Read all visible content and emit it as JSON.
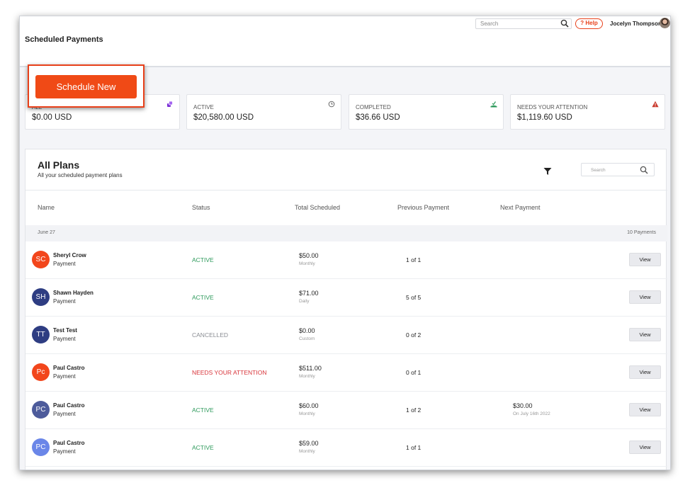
{
  "topbar": {
    "search_placeholder": "Search",
    "help_label": "? Help",
    "user_name": "Jocelyn Thompson"
  },
  "page": {
    "title": "Scheduled Payments",
    "schedule_new_label": "Schedule New"
  },
  "stats": [
    {
      "label": "ALL",
      "value": "$0.00 USD",
      "icon": "stack-icon",
      "icon_color": "#7b2fd6"
    },
    {
      "label": "ACTIVE",
      "value": "$20,580.00 USD",
      "icon": "clock-icon",
      "icon_color": "#666666"
    },
    {
      "label": "COMPLETED",
      "value": "$36.66 USD",
      "icon": "check-tray-icon",
      "icon_color": "#2e9a5c"
    },
    {
      "label": "NEEDS YOUR ATTENTION",
      "value": "$1,119.60 USD",
      "icon": "warning-icon",
      "icon_color": "#c93a2e"
    }
  ],
  "plans": {
    "title": "All Plans",
    "subtitle": "All your scheduled payment plans",
    "search_placeholder": "Search",
    "columns": [
      "Name",
      "Status",
      "Total Scheduled",
      "Previous Payment",
      "Next Payment"
    ],
    "group": {
      "date": "June 27",
      "count": "10 Payments"
    },
    "view_label": "View",
    "rows": [
      {
        "initials": "SC",
        "avatar_color": "#f2461c",
        "name": "Sheryl Crow",
        "type": "Payment",
        "status": "ACTIVE",
        "status_color": "#2e9a5c",
        "amount": "$50.00",
        "frequency": "Monthly",
        "previous": "1 of 1",
        "next": "",
        "next_date": ""
      },
      {
        "initials": "SH",
        "avatar_color": "#2e3d82",
        "name": "Shawn Hayden",
        "type": "Payment",
        "status": "ACTIVE",
        "status_color": "#2e9a5c",
        "amount": "$71.00",
        "frequency": "Daily",
        "previous": "5 of 5",
        "next": "",
        "next_date": ""
      },
      {
        "initials": "TT",
        "avatar_color": "#2e3d82",
        "name": "Test Test",
        "type": "Payment",
        "status": "CANCELLED",
        "status_color": "#8a8d93",
        "amount": "$0.00",
        "frequency": "Custom",
        "previous": "0 of 2",
        "next": "",
        "next_date": ""
      },
      {
        "initials": "Pc",
        "avatar_color": "#f2461c",
        "name": "Paul Castro",
        "type": "Payment",
        "status": "NEEDS YOUR ATTENTION",
        "status_color": "#d8343a",
        "amount": "$511.00",
        "frequency": "Monthly",
        "previous": "0 of 1",
        "next": "",
        "next_date": ""
      },
      {
        "initials": "PC",
        "avatar_color": "#4d5b9b",
        "name": "Paul Castro",
        "type": "Payment",
        "status": "ACTIVE",
        "status_color": "#2e9a5c",
        "amount": "$60.00",
        "frequency": "Monthly",
        "previous": "1 of 2",
        "next": "$30.00",
        "next_date": "On July 16th 2022"
      },
      {
        "initials": "PC",
        "avatar_color": "#6a86e8",
        "name": "Paul Castro",
        "type": "Payment",
        "status": "ACTIVE",
        "status_color": "#2e9a5c",
        "amount": "$59.00",
        "frequency": "Monthly",
        "previous": "1 of 1",
        "next": "",
        "next_date": ""
      }
    ]
  }
}
